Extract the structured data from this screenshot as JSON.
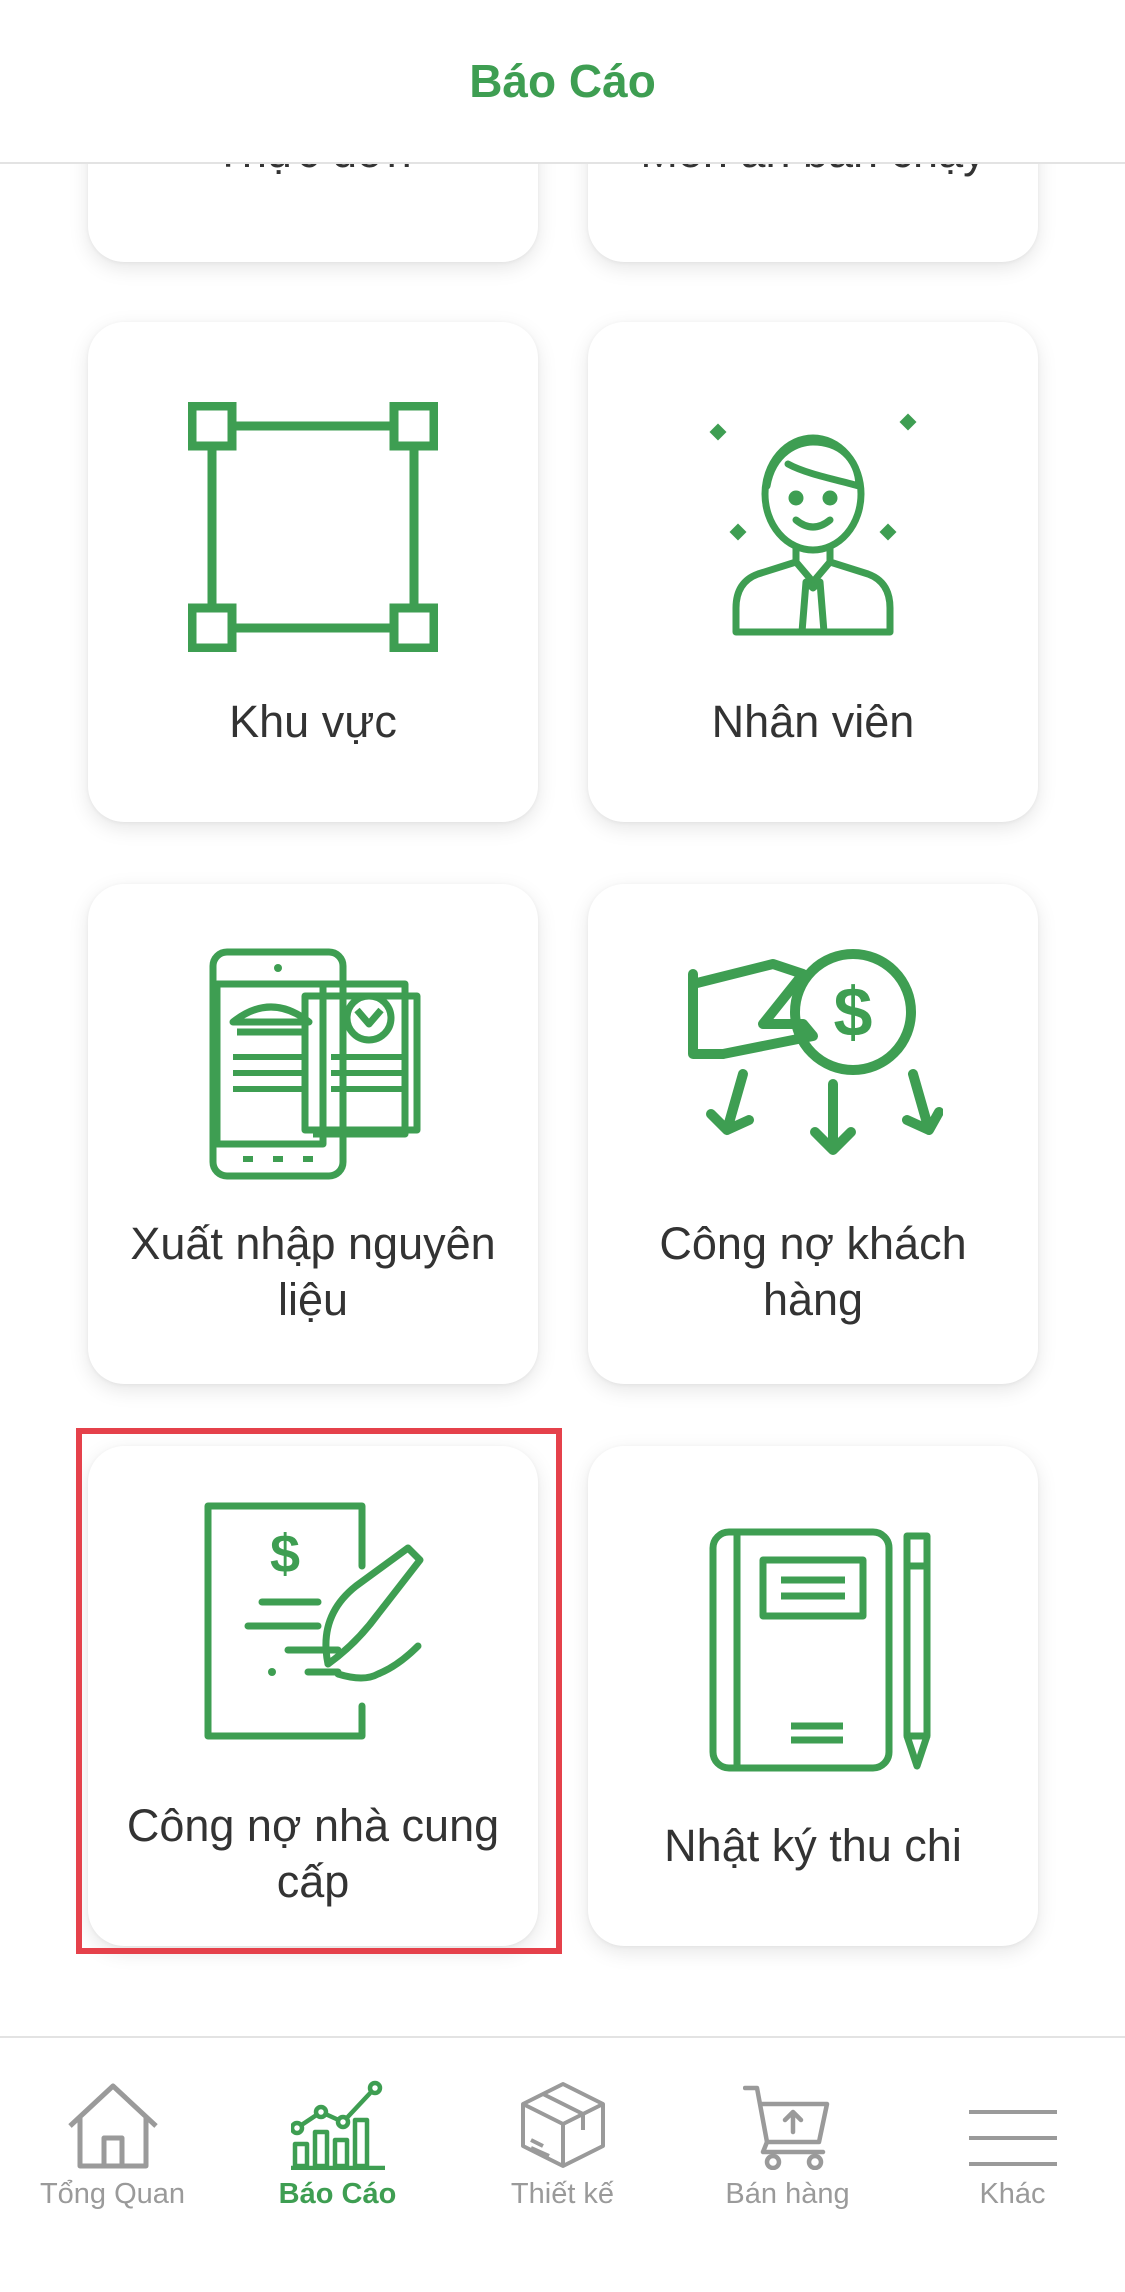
{
  "header": {
    "title": "Báo Cáo"
  },
  "cards": {
    "partial_left": "Thực đơn",
    "partial_right": "Món ăn bán chạy",
    "khu_vuc": "Khu vực",
    "nhan_vien": "Nhân viên",
    "xuat_nhap_line1": "Xuất nhập nguyên",
    "xuat_nhap_line2": "liệu",
    "cong_no_kh_line1": "Công nợ khách",
    "cong_no_kh_line2": "hàng",
    "cong_no_ncc_line1": "Công nợ nhà cung",
    "cong_no_ncc_line2": "cấp",
    "nhat_ky": "Nhật ký thu chi"
  },
  "tabbar": {
    "tabs": [
      {
        "label": "Tổng Quan",
        "icon": "home-icon",
        "active": false
      },
      {
        "label": "Báo Cáo",
        "icon": "chart-icon",
        "active": true
      },
      {
        "label": "Thiết kế",
        "icon": "box-icon",
        "active": false
      },
      {
        "label": "Bán hàng",
        "icon": "cart-icon",
        "active": false
      },
      {
        "label": "Khác",
        "icon": "menu-icon",
        "active": false
      }
    ]
  },
  "colors": {
    "accent": "#3e9e52",
    "highlight": "#e5414b",
    "inactive": "#9a9a9a"
  }
}
